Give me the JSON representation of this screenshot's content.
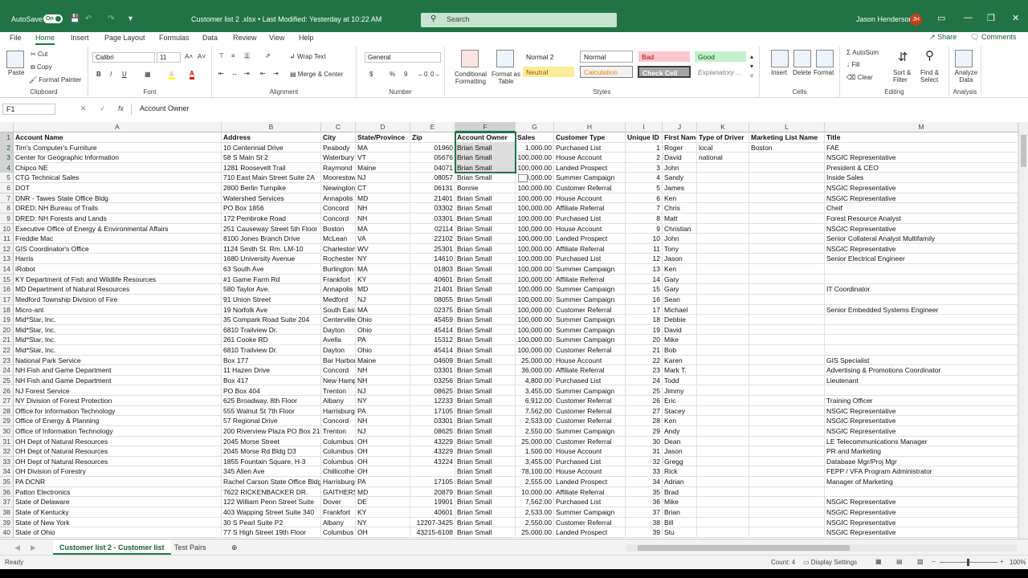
{
  "titlebar": {
    "autosave_label": "AutoSave",
    "autosave_state": "On",
    "document_title": "Customer list 2 .xlsx  •  Last Modified: Yesterday at 10:22 AM",
    "search_placeholder": "Search",
    "user_name": "Jason Henderson",
    "user_initials": "JH"
  },
  "menu": {
    "tabs": [
      "File",
      "Home",
      "Insert",
      "Page Layout",
      "Formulas",
      "Data",
      "Review",
      "View",
      "Help"
    ],
    "share": "Share",
    "comments": "Comments"
  },
  "ribbon": {
    "clipboard": {
      "paste": "Paste",
      "cut": "Cut",
      "copy": "Copy",
      "format_painter": "Format Painter",
      "label": "Clipboard"
    },
    "font": {
      "name": "Calibri",
      "size": "11",
      "label": "Font",
      "bold": "B",
      "italic": "I",
      "underline": "U"
    },
    "alignment": {
      "wrap": "Wrap Text",
      "merge": "Merge & Center",
      "label": "Alignment"
    },
    "number": {
      "format": "General",
      "currency": "$",
      "percent": "%",
      "comma": "9",
      "label": "Number"
    },
    "styles": {
      "conditional": "Conditional Formatting",
      "table": "Format as Table",
      "cells": [
        "Normal 2",
        "Normal",
        "Bad",
        "Good",
        "Neutral",
        "Calculation",
        "Check Cell",
        "Explanatory ..."
      ],
      "label": "Styles"
    },
    "cells": {
      "insert": "Insert",
      "delete": "Delete",
      "format": "Format",
      "label": "Cells"
    },
    "editing": {
      "autosum": "AutoSum",
      "fill": "Fill",
      "clear": "Clear",
      "sort": "Sort & Filter",
      "find": "Find & Select",
      "label": "Editing"
    },
    "analysis": {
      "analyze": "Analyze Data",
      "label": "Analysis"
    }
  },
  "formula_bar": {
    "name_box": "F1",
    "fx": "fx",
    "content": "Account Owner"
  },
  "columns": [
    "A",
    "B",
    "C",
    "D",
    "E",
    "F",
    "G",
    "H",
    "I",
    "J",
    "K",
    "L",
    "M"
  ],
  "selected_column": "F",
  "rows": [
    [
      "Account Name",
      "Address",
      "City",
      "State/Province",
      "Zip",
      "Account Owner",
      "Sales",
      "Customer Type",
      "Unique ID",
      "First Name",
      "Type of Driver",
      "Marketing List Name",
      "Title"
    ],
    [
      "Tim's Computer's Furniture",
      "10 Centennial Drive",
      "Peabody",
      "MA",
      "01960",
      "Brian Small",
      "1,000.00",
      "Purchased List",
      "1",
      "Roger",
      "local",
      "Boston",
      "FAE"
    ],
    [
      "Center for Geographic Information",
      "58 S Main St 2",
      "Waterbury",
      "VT",
      "05676",
      "Brian Small",
      "100,000.00",
      "House Account",
      "2",
      "David",
      "national",
      "",
      "NSGIC Representative"
    ],
    [
      "Chipco NE",
      "1281 Roosevelt Trail",
      "Raymond",
      "Maine",
      "04071",
      "Brian Small",
      "100,000.00",
      "Landed Prospect",
      "3",
      "John",
      "",
      "",
      "President & CEO"
    ],
    [
      "CTG Technical Sales",
      "710 East Main Street Suite 2A",
      "Moorestown",
      "NJ",
      "08057",
      "Brian Small",
      "100,000.00",
      "Summer Campaign",
      "4",
      "Sandy",
      "",
      "",
      "Inside Sales"
    ],
    [
      "DOT",
      "2800 Berlin Turnpike",
      "Newington",
      "CT",
      "06131",
      "Bonnie",
      "100,000.00",
      "Customer Referral",
      "5",
      "James",
      "",
      "",
      "NSGIC Representative"
    ],
    [
      "DNR - Tawes State Office Bldg",
      "Watershed Services",
      "Annapolis",
      "MD",
      "21401",
      "Brian Small",
      "100,000.00",
      "House Account",
      "6",
      "Ken",
      "",
      "",
      "NSGIC Representative"
    ],
    [
      "DRED: NH Bureau of Trails",
      "PO Box 1856",
      "Concord",
      "NH",
      "03302",
      "Brian Small",
      "100,000.00",
      "Affiliate Referral",
      "7",
      "Chris",
      "",
      "",
      "Cheif"
    ],
    [
      "DRED: NH Forests and Lands",
      "172 Pembroke Road",
      "Concord",
      "NH",
      "03301",
      "Brian Small",
      "100,000.00",
      "Purchased List",
      "8",
      "Matt",
      "",
      "",
      "Forest Resource Analyst"
    ],
    [
      "Executive Office of Energy & Environmental Affairs",
      "251 Causeway Street 5th Floor",
      "Boston",
      "MA",
      "02114",
      "Brian Small",
      "100,000.00",
      "House Account",
      "9",
      "Christian",
      "",
      "",
      "NSGIC Representative"
    ],
    [
      "Freddie Mac",
      "8100 Jones Branch Drive",
      "McLean",
      "VA",
      "22102",
      "Brian Small",
      "100,000.00",
      "Landed Prospect",
      "10",
      "John",
      "",
      "",
      "Senior Collateral Analyst Multifamily"
    ],
    [
      "GIS Coordinator's Office",
      "1124 Smith St. Rm. LM-10",
      "Charleston",
      "WV",
      "25301",
      "Brian Small",
      "100,000.00",
      "Affiliate Referral",
      "11",
      "Tony",
      "",
      "",
      "NSGIC Representative"
    ],
    [
      "Harris",
      "1680 University Avenue",
      "Rochester",
      "NY",
      "14610",
      "Brian Small",
      "100,000.00",
      "Purchased List",
      "12",
      "Jason",
      "",
      "",
      "Senior Electrical Engineer"
    ],
    [
      "iRobot",
      "63 South Ave",
      "Burlington",
      "MA",
      "01803",
      "Brian Small",
      "100,000.00",
      "Summer Campaign",
      "13",
      "Ken",
      "",
      "",
      ""
    ],
    [
      "KY Department of Fish and Wildlife Resources",
      "#1 Game Farm Rd",
      "Frankfort",
      "KY",
      "40601",
      "Brian Small",
      "100,000.00",
      "Affiliate Referral",
      "14",
      "Gary",
      "",
      "",
      ""
    ],
    [
      "MD Department of Natural Resources",
      "580 Taylor Ave.",
      "Annapolis",
      "MD",
      "21401",
      "Brian Small",
      "100,000.00",
      "Summer Campaign",
      "15",
      "Gary",
      "",
      "",
      "IT Coordinator"
    ],
    [
      "Medford Township Division of Fire",
      "91 Union Street",
      "Medford",
      "NJ",
      "08055",
      "Brian Small",
      "100,000.00",
      "Summer Campaign",
      "16",
      "Sean",
      "",
      "",
      ""
    ],
    [
      "Micro-ant",
      "19 Norfolk Ave",
      "South Easton",
      "MA",
      "02375",
      "Brian Small",
      "100,000.00",
      "Customer Referral",
      "17",
      "Michael",
      "",
      "",
      "Senior Embedded Systems Engineer"
    ],
    [
      "Mid*Star, Inc.",
      "35 Compark Road Suite 204",
      "Centerville",
      "Ohio",
      "45459",
      "Brian Small",
      "100,000.00",
      "Summer Campaign",
      "18",
      "Debbie",
      "",
      "",
      ""
    ],
    [
      "Mid*Star, Inc.",
      "6810 Trailview Dr.",
      "Dayton",
      "Ohio",
      "45414",
      "Brian Small",
      "100,000.00",
      "Summer Campaign",
      "19",
      "David",
      "",
      "",
      ""
    ],
    [
      "Mid*Star, Inc.",
      "261 Cooke RD",
      "Avella",
      "PA",
      "15312",
      "Brian Small",
      "100,000.00",
      "Summer Campaign",
      "20",
      "Mike",
      "",
      "",
      ""
    ],
    [
      "Mid*Star, Inc.",
      "6810 Trailview Dr.",
      "Dayton",
      "Ohio",
      "45414",
      "Brian Small",
      "100,000.00",
      "Customer Referral",
      "21",
      "Bob",
      "",
      "",
      ""
    ],
    [
      "National Park Service",
      "Box 177",
      "Bar Harbor",
      "Maine",
      "04609",
      "Brian Small",
      "25,000.00",
      "House Account",
      "22",
      "Karen",
      "",
      "",
      "GIS Specialist"
    ],
    [
      "NH Fish and Game Department",
      "11 Hazen Drive",
      "Concord",
      "NH",
      "03301",
      "Brian Small",
      "36,000.00",
      "Affiliate Referral",
      "23",
      "Mark T.",
      "",
      "",
      "Advertising & Promotions Coordinator"
    ],
    [
      "NH Fish and Game Department",
      "Box 417",
      "New Hampton",
      "NH",
      "03256",
      "Brian Small",
      "4,800.00",
      "Purchased List",
      "24",
      "Todd",
      "",
      "",
      "Lieutenant"
    ],
    [
      "NJ Forest Service",
      "PO Box 404",
      "Trenton",
      "NJ",
      "08625",
      "Brian Small",
      "3,455.00",
      "Summer Campaign",
      "25",
      "Jimmy",
      "",
      "",
      ""
    ],
    [
      "NY Division of Forest Protection",
      "625 Broadway, 8th Floor",
      "Albany",
      "NY",
      "12233",
      "Brian Small",
      "6,912.00",
      "Customer Referral",
      "26",
      "Eric",
      "",
      "",
      "Training Officer"
    ],
    [
      "Office for Information Technology",
      "555 Walnut St 7th Floor",
      "Harrisburg",
      "PA",
      "17105",
      "Brian Small",
      "7,562.00",
      "Customer Referral",
      "27",
      "Stacey",
      "",
      "",
      "NSGIC Representative"
    ],
    [
      "Office of Energy & Planning",
      "57 Regional Drive",
      "Concord",
      "NH",
      "03301",
      "Brian Small",
      "2,533.00",
      "Customer Referral",
      "28",
      "Ken",
      "",
      "",
      "NSGIC Representative"
    ],
    [
      "Office of Information Technology",
      "200 Riverview Plaza PO Box 212",
      "Trenton",
      "NJ",
      "08625",
      "Brian Small",
      "2,550.00",
      "Summer Campaign",
      "29",
      "Andy",
      "",
      "",
      "NSGIC Representative"
    ],
    [
      "OH Dept of Natural Resources",
      "2045 Morse Street",
      "Columbus",
      "OH",
      "43229",
      "Brian Small",
      "25,000.00",
      "Customer Referral",
      "30",
      "Dean",
      "",
      "",
      "LE Telecommunications Manager"
    ],
    [
      "OH Dept of Natural Resources",
      "2045 Morse Rd Bldg D3",
      "Columbus",
      "OH",
      "43229",
      "Brian Small",
      "1,500.00",
      "House Account",
      "31",
      "Jason",
      "",
      "",
      "PR and Marketing"
    ],
    [
      "OH Dept of Natural Resources",
      "1855 Fountain Square, H-3",
      "Columbus",
      "OH",
      "43224",
      "Brian Small",
      "3,455.00",
      "Purchased List",
      "32",
      "Gregg",
      "",
      "",
      "Database Mgr/Proj Mgr"
    ],
    [
      "OH Division of Forestry",
      "345 Allen Ave",
      "Chillicothe",
      "OH",
      "",
      "Brian Small",
      "78,100.00",
      "House Account",
      "33",
      "Rick",
      "",
      "",
      "FEPP / VFA Program Administrator"
    ],
    [
      "PA DCNR",
      "Rachel Carson State Office Bldg",
      "Harrisburg",
      "PA",
      "17105",
      "Brian Small",
      "2,555.00",
      "Landed Prospect",
      "34",
      "Adrian",
      "",
      "",
      "Manager of Marketing"
    ],
    [
      "Patton Electronics",
      "7622 RICKENBACKER DR.",
      "GAITHERSBURG",
      "MD",
      "20879",
      "Brian Small",
      "10,000.00",
      "Affiliate Referral",
      "35",
      "Brad",
      "",
      "",
      ""
    ],
    [
      "State of Delaware",
      "122 William Penn Street Suite",
      "Dover",
      "DE",
      "19901",
      "Brian Small",
      "7,562.00",
      "Purchased List",
      "36",
      "Mike",
      "",
      "",
      "NSGIC Representative"
    ],
    [
      "State of Kentucky",
      "403 Wapping Street Suite 340",
      "Frankfort",
      "KY",
      "40601",
      "Brian Small",
      "2,533.00",
      "Summer Campaign",
      "37",
      "Brian",
      "",
      "",
      "NSGIC Representative"
    ],
    [
      "State of New York",
      "30 S Pearl Suite P2",
      "Albany",
      "NY",
      "12207-3425",
      "Brian Small",
      "2,550.00",
      "Customer Referral",
      "38",
      "Bill",
      "",
      "",
      "NSGIC Representative"
    ],
    [
      "State of Ohio",
      "77 S High Street 19th Floor",
      "Columbus",
      "OH",
      "43215-6108",
      "Brian Small",
      "25,000.00",
      "Landed Prospect",
      "39",
      "Stu",
      "",
      "",
      "NSGIC Representative"
    ]
  ],
  "sheets": [
    "Customer list 2 - Customer list",
    "Test Pairs"
  ],
  "status": {
    "ready": "Ready",
    "count": "Count: 4",
    "display_settings": "Display Settings",
    "zoom": "100%"
  }
}
